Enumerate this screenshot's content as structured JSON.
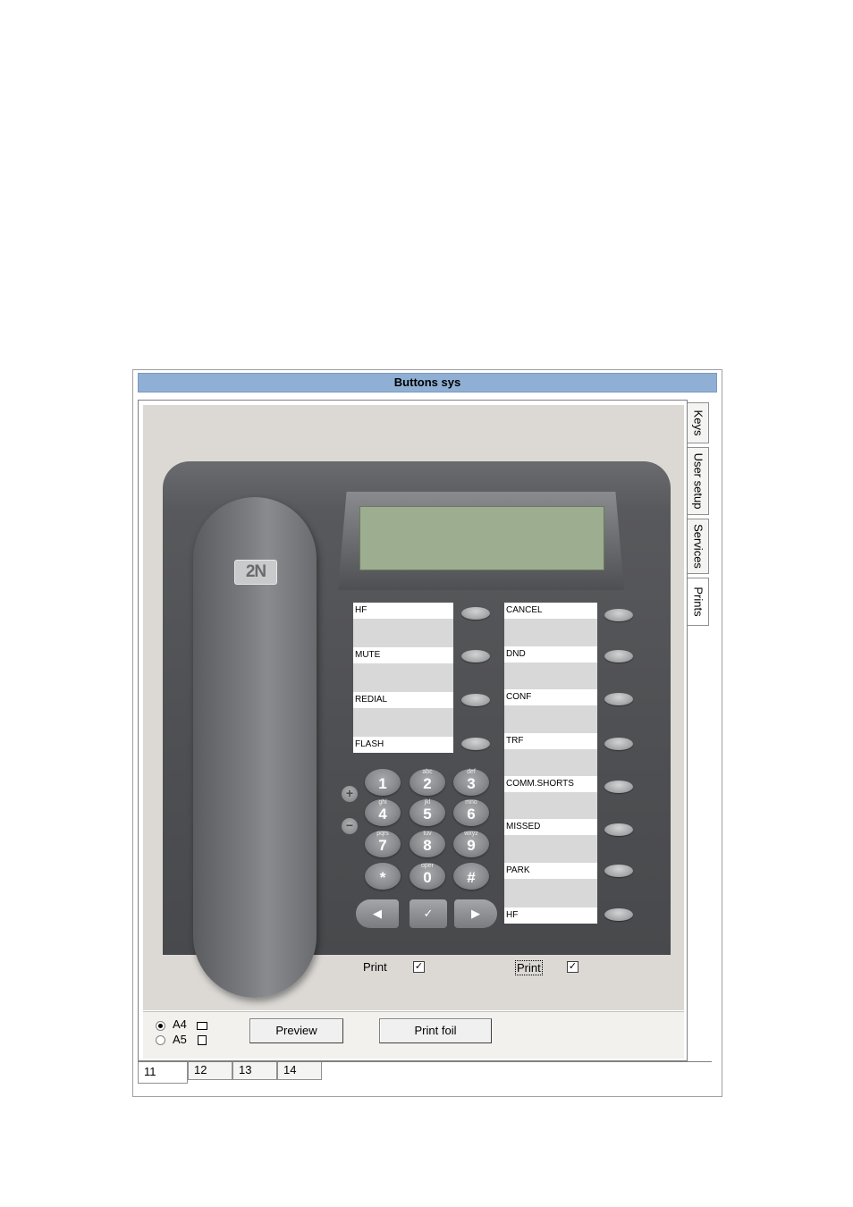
{
  "window": {
    "title": "Buttons sys"
  },
  "side_tabs": [
    {
      "label": "Keys"
    },
    {
      "label": "User setup"
    },
    {
      "label": "Services"
    },
    {
      "label": "Prints"
    }
  ],
  "phone": {
    "logo": "2N",
    "left_labels": [
      "HF",
      "MUTE",
      "REDIAL",
      "FLASH"
    ],
    "right_labels": [
      "CANCEL",
      "DND",
      "CONF",
      "TRF",
      "COMM.SHORTS",
      "MISSED",
      "PARK",
      "HF"
    ],
    "keypad": [
      {
        "digit": "1",
        "letters": ""
      },
      {
        "digit": "2",
        "letters": "abc"
      },
      {
        "digit": "3",
        "letters": "def"
      },
      {
        "digit": "4",
        "letters": "ghi"
      },
      {
        "digit": "5",
        "letters": "jkl"
      },
      {
        "digit": "6",
        "letters": "mno"
      },
      {
        "digit": "7",
        "letters": "pqrs"
      },
      {
        "digit": "8",
        "letters": "tuv"
      },
      {
        "digit": "9",
        "letters": "wxyz"
      },
      {
        "digit": "*",
        "letters": ""
      },
      {
        "digit": "0",
        "letters": "oper"
      },
      {
        "digit": "#",
        "letters": ""
      }
    ],
    "volume_plus": "+",
    "volume_minus": "−",
    "nav_left": "◀",
    "nav_ok": "✓",
    "nav_right": "▶"
  },
  "print_options": [
    {
      "label": "Print",
      "checked": true
    },
    {
      "label": "Print",
      "checked": true
    }
  ],
  "paper": {
    "a4_label": "A4",
    "a5_label": "A5",
    "selected": "A4"
  },
  "buttons": {
    "preview": "Preview",
    "print_foil": "Print foil"
  },
  "bottom_tabs": [
    {
      "label": "11"
    },
    {
      "label": "12"
    },
    {
      "label": "13"
    },
    {
      "label": "14"
    }
  ],
  "colors": {
    "titlebar": "#8fb0d4",
    "display": "#9dad8f",
    "phone_body": "#4e4f52"
  }
}
